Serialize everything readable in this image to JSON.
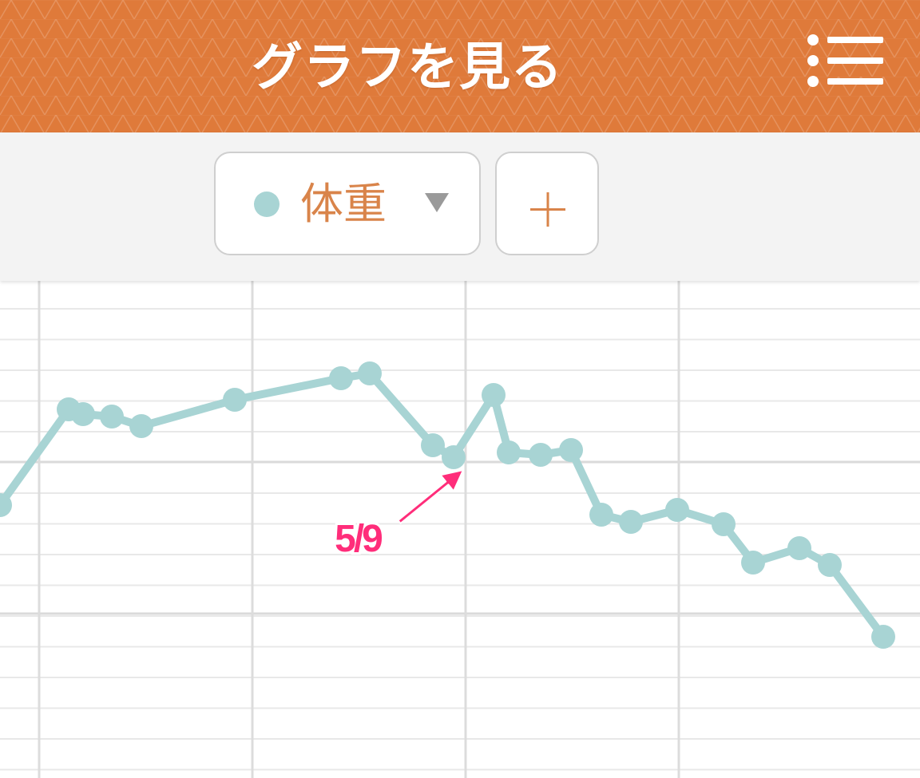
{
  "header": {
    "title": "グラフを見る",
    "menu_icon": "menu-list-icon",
    "background_color": "#df7a3a"
  },
  "toolbar": {
    "series_select": {
      "selected_label": "体重",
      "dot_color": "#a8d4d4",
      "label_color": "#d9844a",
      "caret_icon": "caret-down-icon"
    },
    "add_button": {
      "icon": "plus-icon",
      "color": "#d9844a"
    }
  },
  "chart_data": {
    "type": "line",
    "title": "",
    "xlabel": "",
    "ylabel": "",
    "grid": true,
    "line_color": "#a8d4d4",
    "series": [
      {
        "values": [
          1.35,
          1.75,
          1.73,
          1.72,
          1.68,
          1.79,
          1.88,
          1.9,
          1.6,
          1.55,
          1.81,
          1.57,
          1.56,
          1.58,
          1.31,
          1.28,
          1.33,
          1.27,
          1.11,
          1.17,
          1.1,
          0.8
        ]
      }
    ],
    "annotation": {
      "text": "5/9",
      "color": "#ff2d7a"
    }
  }
}
